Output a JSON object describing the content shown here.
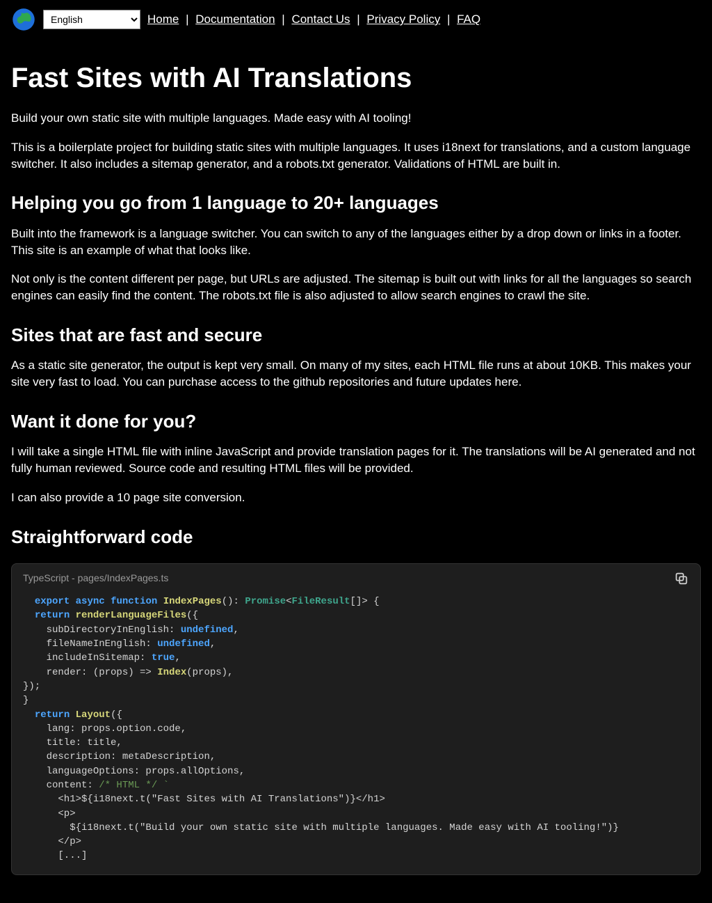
{
  "nav": {
    "language_selected": "English",
    "items": [
      "Home",
      "Documentation",
      "Contact Us",
      "Privacy Policy",
      "FAQ"
    ],
    "separator": " | "
  },
  "h1": "Fast Sites with AI Translations",
  "p1": "Build your own static site with multiple languages. Made easy with AI tooling!",
  "p2": "This is a boilerplate project for building static sites with multiple languages. It uses i18next for translations, and a custom language switcher. It also includes a sitemap generator, and a robots.txt generator. Validations of HTML are built in.",
  "h2a": "Helping you go from 1 language to 20+ languages",
  "p3": "Built into the framework is a language switcher. You can switch to any of the languages either by a drop down or links in a footer. This site is an example of what that looks like.",
  "p4": "Not only is the content different per page, but URLs are adjusted. The sitemap is built out with links for all the languages so search engines can easily find the content. The robots.txt file is also adjusted to allow search engines to crawl the site.",
  "h2b": "Sites that are fast and secure",
  "p5": "As a static site generator, the output is kept very small. On many of my sites, each HTML file runs at about 10KB. This makes your site very fast to load. You can purchase access to the github repositories and future updates here.",
  "h2c": "Want it done for you?",
  "p6": "I will take a single HTML file with inline JavaScript and provide translation pages for it. The translations will be AI generated and not fully human reviewed. Source code and resulting HTML files will be provided.",
  "p7": "I can also provide a 10 page site conversion.",
  "h2d": "Straightforward code",
  "code": {
    "label": "TypeScript - pages/IndexPages.ts",
    "c": {
      "export": "export",
      "async": "async",
      "function": "function",
      "IndexPages": "IndexPages",
      "sig1": "(): ",
      "Promise": "Promise",
      "lt": "<",
      "FileResult": "FileResult",
      "sig2": "[]> {",
      "return": "return",
      "renderLanguageFiles": "renderLanguageFiles",
      "open": "({",
      "subDir": "    subDirectoryInEnglish: ",
      "undefined": "undefined",
      "comma": ",",
      "fileName": "    fileNameInEnglish: ",
      "include": "    includeInSitemap: ",
      "true": "true",
      "renderLine": "    render: (props) => ",
      "Index": "Index",
      "renderTail": "(props),",
      "closeObj": "});",
      "closeFn": "}",
      "Layout": "Layout",
      "lang": "    lang: props.option.code,",
      "title": "    title: title,",
      "desc": "    description: metaDescription,",
      "opts": "    languageOptions: props.allOptions,",
      "content": "    content: ",
      "htmlComment": "/* HTML */ `",
      "tpl1": "      <h1>${i18next.t(\"Fast Sites with AI Translations\")}</h1>",
      "tpl2": "      <p>",
      "tpl3": "        ${i18next.t(\"Build your own static site with multiple languages. Made easy with AI tooling!\")}",
      "tpl4": "      </p>",
      "tpl5": "      [...]"
    }
  }
}
